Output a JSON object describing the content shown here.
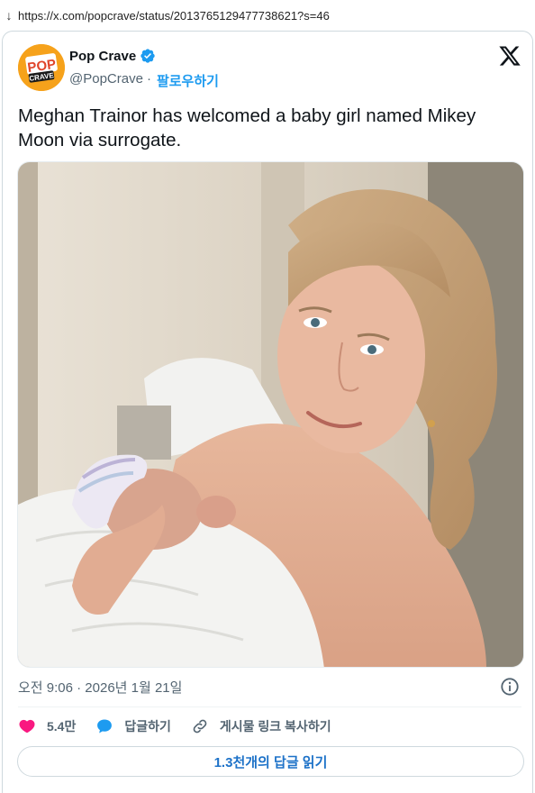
{
  "browser": {
    "url": "https://x.com/popcrave/status/2013765129477738621?s=46"
  },
  "author": {
    "avatar_line1": "POP",
    "avatar_line2": "CRAVE",
    "display_name": "Pop Crave",
    "handle": "@PopCrave",
    "separator": "·",
    "follow_label": "팔로우하기"
  },
  "tweet": {
    "text": "Meghan Trainor has welcomed a baby girl named Mikey Moon via surrogate.",
    "timestamp": "오전 9:06 · 2026년 1월 21일"
  },
  "actions": {
    "likes": "5.4만",
    "reply_label": "답글하기",
    "copy_link_label": "게시물 링크 복사하기"
  },
  "replies_button": {
    "label": "1.3천개의 답글 읽기"
  },
  "colors": {
    "accent": "#1d9bf0",
    "like": "#f91880",
    "avatar_bg": "#f6a21b"
  }
}
